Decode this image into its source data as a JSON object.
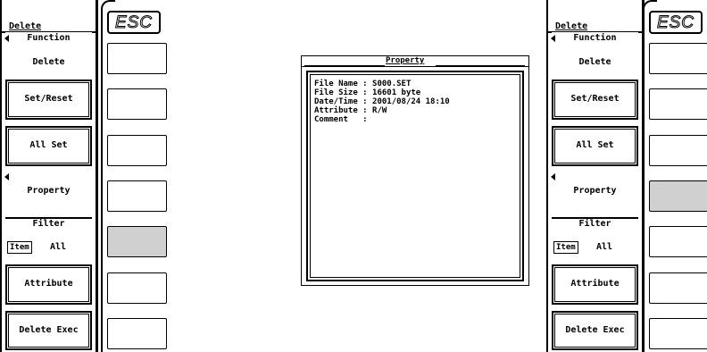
{
  "left_menu": {
    "header": "Delete",
    "function_label": "Function",
    "function_value": "Delete",
    "set_reset": "Set/Reset",
    "all_set": "All Set",
    "property": "Property",
    "filter_label": "Filter",
    "filter_item": "Item",
    "filter_value": "All",
    "attribute": "Attribute",
    "delete_exec": "Delete Exec"
  },
  "right_menu": {
    "header": "Delete",
    "function_label": "Function",
    "function_value": "Delete",
    "set_reset": "Set/Reset",
    "all_set": "All Set",
    "property": "Property",
    "filter_label": "Filter",
    "filter_item": "Item",
    "filter_value": "All",
    "attribute": "Attribute",
    "delete_exec": "Delete Exec"
  },
  "keys": {
    "esc": "ESC",
    "left_active_index": 5,
    "right_active_index": 4
  },
  "dialog": {
    "title": "Property",
    "rows": [
      "File Name : S000.SET",
      "File Size : 16601 byte",
      "Date/Time : 2001/08/24 18:10",
      "Attribute : R/W",
      "Comment   :"
    ]
  },
  "colors": {
    "border": "#000000",
    "background": "#ffffff",
    "active_key": "#d0d0d0"
  }
}
